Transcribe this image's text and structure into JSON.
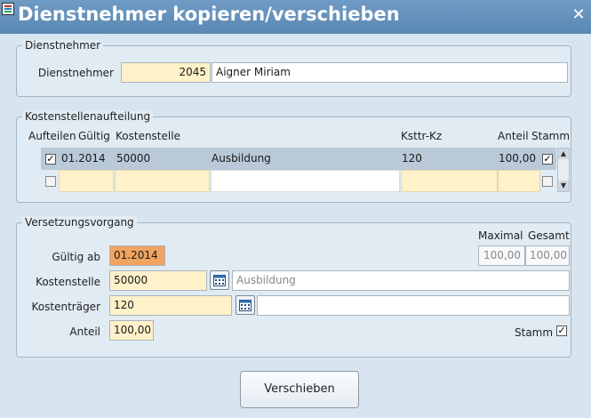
{
  "window": {
    "title": "Dienstnehmer kopieren/verschieben",
    "close_glyph": "✕"
  },
  "dienstnehmer": {
    "legend": "Dienstnehmer",
    "label": "Dienstnehmer",
    "number": "2045",
    "name": "Aigner Miriam"
  },
  "kostenstellen": {
    "legend": "Kostenstellenaufteilung",
    "headers": {
      "aufteilen": "Aufteilen",
      "gueltig": "Gültig",
      "kostenstelle": "Kostenstelle",
      "ksttr": "Ksttr-Kz",
      "anteil": "Anteil",
      "stamm": "Stamm"
    },
    "rows": [
      {
        "aufteilen": true,
        "gueltig": "01.2014",
        "kostenstelle": "50000",
        "bezeichnung": "Ausbildung",
        "ksttr": "120",
        "anteil": "100,00",
        "stamm": true
      },
      {
        "aufteilen": false,
        "gueltig": "",
        "kostenstelle": "",
        "bezeichnung": "",
        "ksttr": "",
        "anteil": "",
        "stamm": false
      }
    ]
  },
  "versetzung": {
    "legend": "Versetzungsvorgang",
    "maximal_label": "Maximal",
    "gesamt_label": "Gesamt",
    "maximal": "100,00",
    "gesamt": "100,00",
    "gueltig_label": "Gültig ab",
    "gueltig": "01.2014",
    "kostenstelle_label": "Kostenstelle",
    "kostenstelle": "50000",
    "kostenstelle_bez": "Ausbildung",
    "kostentraeger_label": "Kostenträger",
    "kostentraeger": "120",
    "kostentraeger_bez": "",
    "anteil_label": "Anteil",
    "anteil": "100,00",
    "stamm_label": "Stamm",
    "stamm": true
  },
  "actions": {
    "verschieben": "Verschieben"
  },
  "colors": {
    "titlebar": "#5a88b4",
    "required": "#fff1c9",
    "active": "#f0a460",
    "selected_row": "#b9c9d8"
  }
}
